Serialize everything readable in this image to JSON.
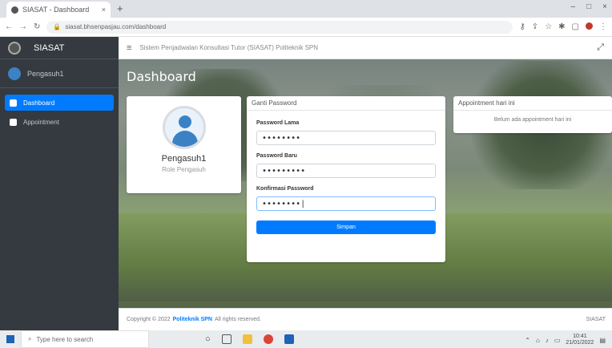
{
  "browser": {
    "tab_title": "SIASAT - Dashboard",
    "tab_close": "×",
    "new_tab": "+",
    "window_controls": [
      "–",
      "□",
      "×"
    ],
    "url": "siasat.bhsenpasjau.com/dashboard"
  },
  "sidebar": {
    "brand": "SIASAT",
    "user_name": "Pengasuh1",
    "items": [
      {
        "label": "Dashboard",
        "active": true,
        "icon": "dashboard-icon"
      },
      {
        "label": "Appointment",
        "active": false,
        "icon": "file-icon"
      }
    ]
  },
  "topnav": {
    "menu_icon": "≡",
    "system_title": "Sistem Penjadwalan Konsultasi Tutor (SIASAT) Politeknik SPN",
    "expand_icon": "⤢"
  },
  "page": {
    "title": "Dashboard"
  },
  "profile": {
    "name": "Pengasuh1",
    "role": "Role Pengasuh"
  },
  "password_card": {
    "header": "Ganti Password",
    "old_label": "Password Lama",
    "old_value": "••••••••",
    "new_label": "Password Baru",
    "new_value": "•••••••••",
    "confirm_label": "Konfirmasi Password",
    "confirm_value": "••••••••|",
    "save_label": "Simpan"
  },
  "appointment_card": {
    "header": "Appointment hari ini",
    "empty_text": "Belum ada appointment hari ini"
  },
  "footer": {
    "copyright": "Copyright © 2022",
    "brand": "Politeknik SPN",
    "rights": "All rights reserved.",
    "version": "SIASAT"
  },
  "taskbar": {
    "search_placeholder": "Type here to search",
    "time": "10:41",
    "date": "21/01/2022"
  },
  "colors": {
    "sidebar_bg": "#343a40",
    "accent": "#007bff",
    "active_nav": "#007bff"
  }
}
